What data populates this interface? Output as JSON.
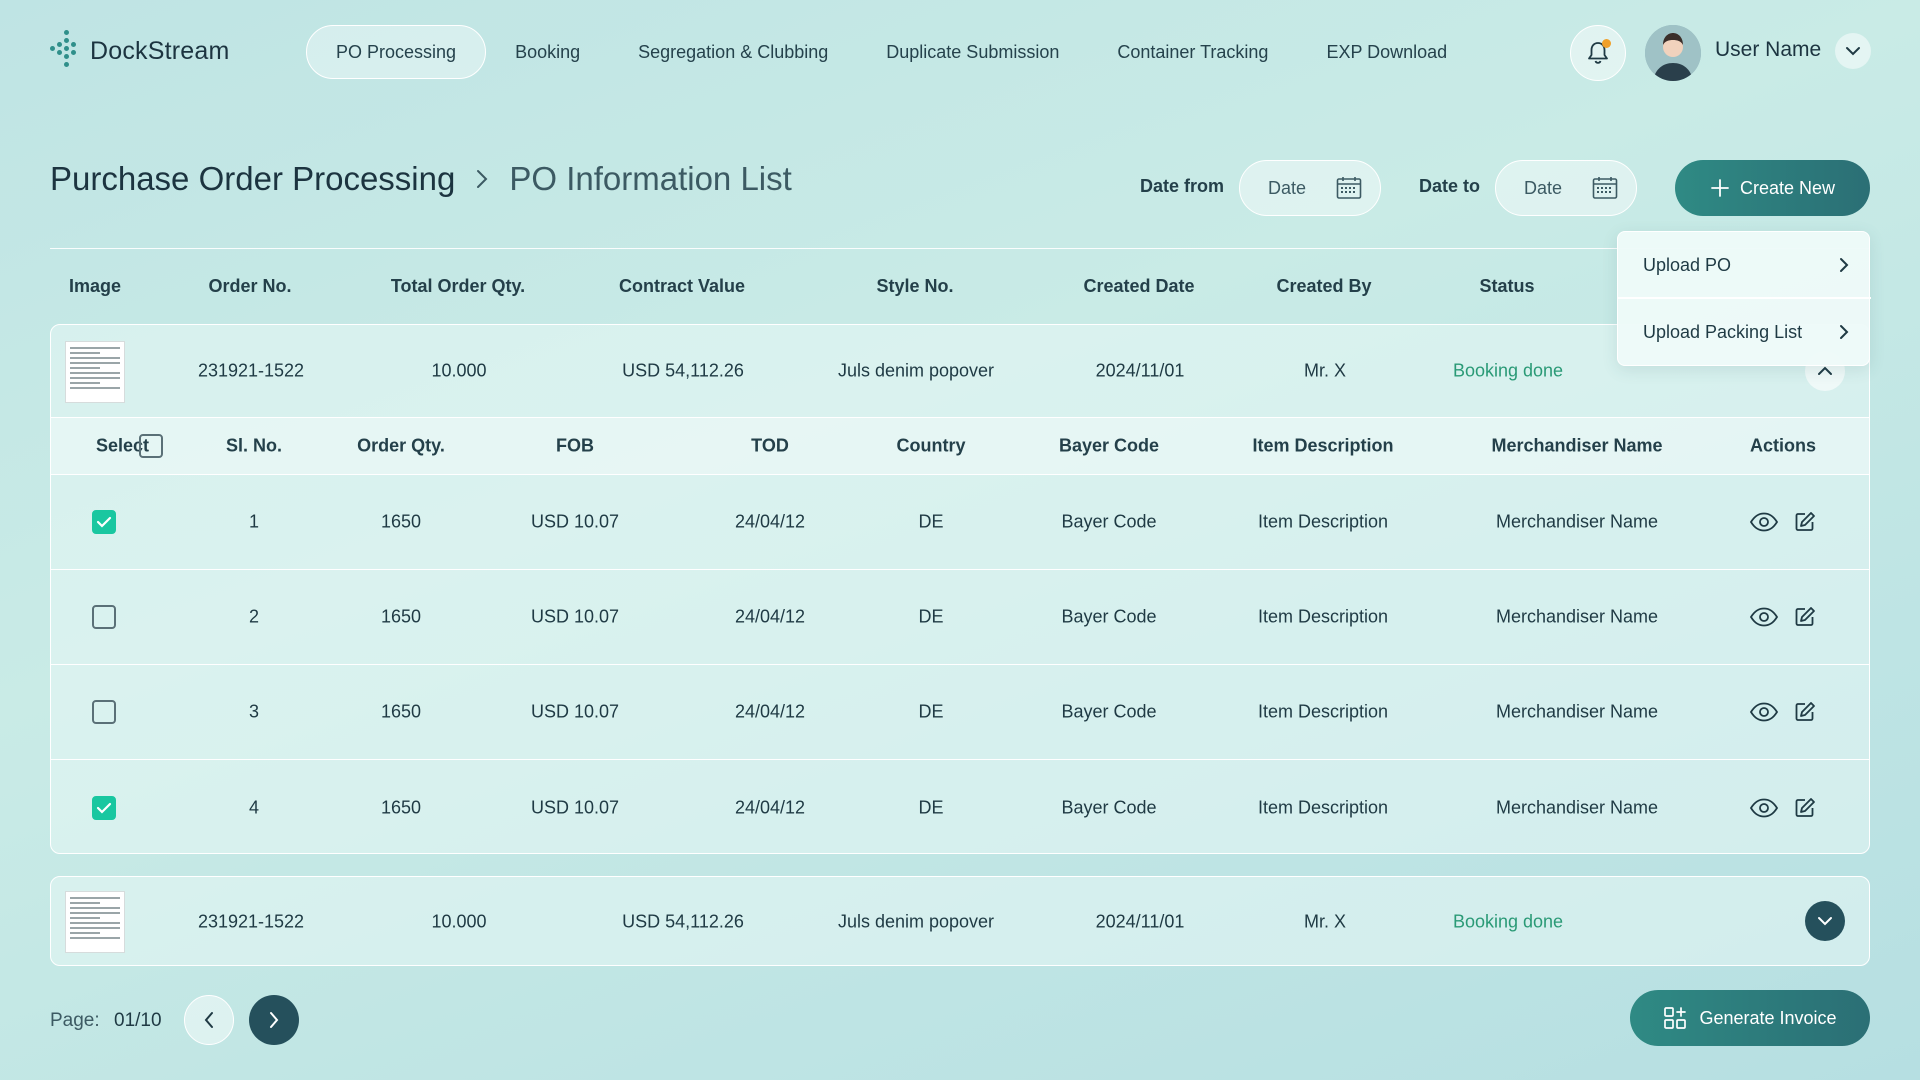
{
  "app": {
    "name": "DockStream"
  },
  "nav": {
    "items": [
      {
        "label": "PO Processing"
      },
      {
        "label": "Booking"
      },
      {
        "label": "Segregation & Clubbing"
      },
      {
        "label": "Duplicate Submission"
      },
      {
        "label": "Container Tracking"
      },
      {
        "label": "EXP Download"
      }
    ]
  },
  "user": {
    "name": "User Name"
  },
  "breadcrumb": {
    "title": "Purchase Order Processing",
    "subtitle": "PO Information List"
  },
  "filters": {
    "date_from_label": "Date from",
    "date_to_label": "Date to",
    "date_placeholder": "Date"
  },
  "actions": {
    "create_label": "Create New",
    "invoice_label": "Generate Invoice"
  },
  "dropdown": {
    "items": [
      {
        "label": "Upload PO"
      },
      {
        "label": "Upload Packing List"
      }
    ]
  },
  "table": {
    "headers": [
      "Image",
      "Order No.",
      "Total Order Qty.",
      "Contract Value",
      "Style No.",
      "Created Date",
      "Created By",
      "Status"
    ],
    "orders": [
      {
        "order_no": "231921-1522",
        "total_qty": "10.000",
        "contract_value": "USD 54,112.26",
        "style_no": "Juls denim popover",
        "created_date": "2024/11/01",
        "created_by": "Mr. X",
        "status": "Booking done",
        "expanded": true
      },
      {
        "order_no": "231921-1522",
        "total_qty": "10.000",
        "contract_value": "USD 54,112.26",
        "style_no": "Juls denim popover",
        "created_date": "2024/11/01",
        "created_by": "Mr. X",
        "status": "Booking done",
        "expanded": false
      }
    ],
    "sub_headers": [
      "Select",
      "Sl. No.",
      "Order Qty.",
      "FOB",
      "TOD",
      "Country",
      "Bayer Code",
      "Item Description",
      "Merchandiser Name",
      "Actions"
    ],
    "items": [
      {
        "selected": true,
        "sl": "1",
        "qty": "1650",
        "fob": "USD 10.07",
        "tod": "24/04/12",
        "country": "DE",
        "bayer_code": "Bayer Code",
        "description": "Item Description",
        "merchandiser": "Merchandiser Name"
      },
      {
        "selected": false,
        "sl": "2",
        "qty": "1650",
        "fob": "USD 10.07",
        "tod": "24/04/12",
        "country": "DE",
        "bayer_code": "Bayer Code",
        "description": "Item Description",
        "merchandiser": "Merchandiser Name"
      },
      {
        "selected": false,
        "sl": "3",
        "qty": "1650",
        "fob": "USD 10.07",
        "tod": "24/04/12",
        "country": "DE",
        "bayer_code": "Bayer Code",
        "description": "Item Description",
        "merchandiser": "Merchandiser Name"
      },
      {
        "selected": true,
        "sl": "4",
        "qty": "1650",
        "fob": "USD 10.07",
        "tod": "24/04/12",
        "country": "DE",
        "bayer_code": "Bayer Code",
        "description": "Item Description",
        "merchandiser": "Merchandiser Name"
      }
    ]
  },
  "pagination": {
    "label": "Page:",
    "value": "01/10"
  },
  "colors": {
    "accent": "#2f8a84",
    "status_done": "#2a9a76",
    "checkbox_on": "#19c7a0",
    "dark_button": "#25505c"
  },
  "icons": [
    "logo-icon",
    "bell-icon",
    "avatar-icon",
    "chevron-down-icon",
    "chevron-right-icon",
    "calendar-icon",
    "plus-icon",
    "chevron-up-icon",
    "eye-icon",
    "edit-icon",
    "chevron-left-icon",
    "grid-icon"
  ]
}
